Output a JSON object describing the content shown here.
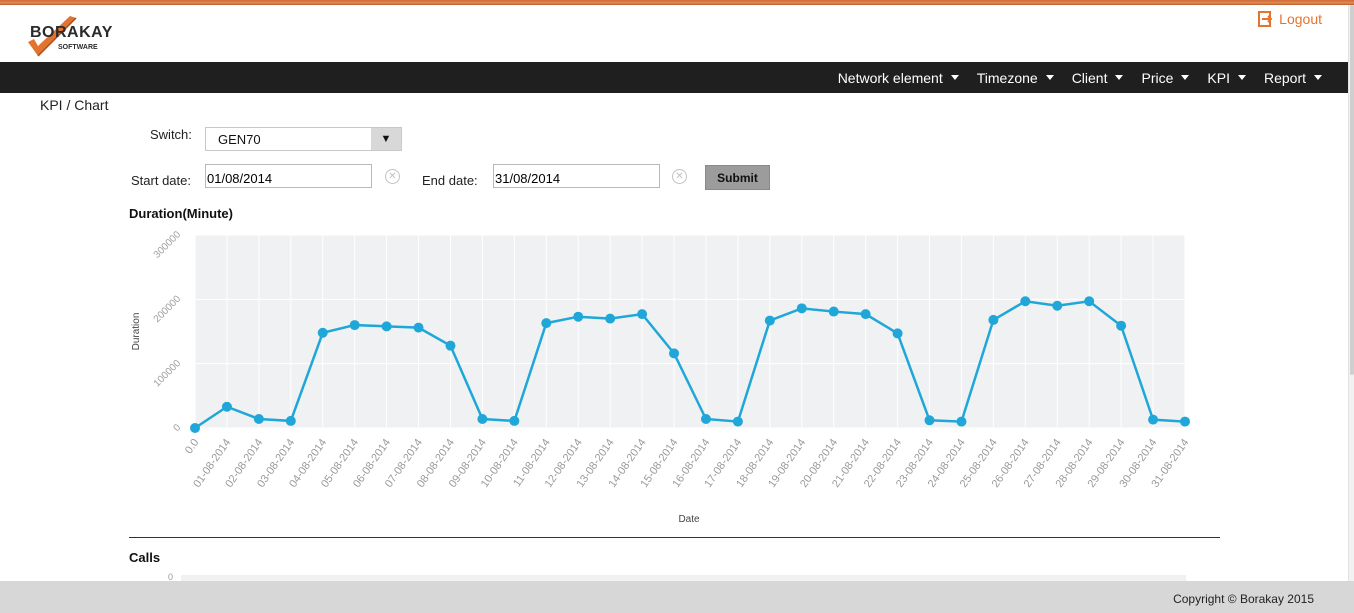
{
  "header": {
    "logo": {
      "name": "BORAKAY",
      "subtitle": "SOFTWARE"
    },
    "logout_label": "Logout"
  },
  "nav": {
    "items": [
      "Network element",
      "Timezone",
      "Client",
      "Price",
      "KPI",
      "Report"
    ]
  },
  "breadcrumb": "KPI / Chart",
  "form": {
    "switch_label": "Switch:",
    "switch_value": "GEN70",
    "start_label": "Start date:",
    "start_value": "01/08/2014",
    "end_label": "End date:",
    "end_value": "31/08/2014",
    "submit_label": "Submit"
  },
  "sections": {
    "duration_title": "Duration(Minute)",
    "calls_title": "Calls",
    "calls_first_tick": "0"
  },
  "colors": {
    "accent": "#e2742f",
    "navbar": "#1f1f1f",
    "series": "#1ea7d8"
  },
  "chart_data": {
    "type": "line",
    "title": "Duration(Minute)",
    "xlabel": "Date",
    "ylabel": "Duration",
    "ylim": [
      0,
      300000
    ],
    "yticks": [
      "0",
      "100000",
      "200000",
      "300000"
    ],
    "grid": true,
    "categories": [
      "0.0",
      "01-08-2014",
      "02-08-2014",
      "03-08-2014",
      "04-08-2014",
      "05-08-2014",
      "06-08-2014",
      "07-08-2014",
      "08-08-2014",
      "09-08-2014",
      "10-08-2014",
      "11-08-2014",
      "12-08-2014",
      "13-08-2014",
      "14-08-2014",
      "15-08-2014",
      "16-08-2014",
      "17-08-2014",
      "18-08-2014",
      "19-08-2014",
      "20-08-2014",
      "21-08-2014",
      "22-08-2014",
      "23-08-2014",
      "24-08-2014",
      "25-08-2014",
      "26-08-2014",
      "27-08-2014",
      "28-08-2014",
      "29-08-2014",
      "30-08-2014",
      "31-08-2014"
    ],
    "values": [
      0,
      33000,
      14000,
      11000,
      148000,
      160000,
      158000,
      156000,
      128000,
      14000,
      11000,
      163000,
      173000,
      170000,
      177000,
      116000,
      14000,
      10000,
      167000,
      186000,
      181000,
      177000,
      147000,
      12000,
      10000,
      168000,
      197000,
      190000,
      197000,
      159000,
      13000,
      10000
    ]
  },
  "footer": {
    "copyright": "Copyright © Borakay 2015"
  }
}
